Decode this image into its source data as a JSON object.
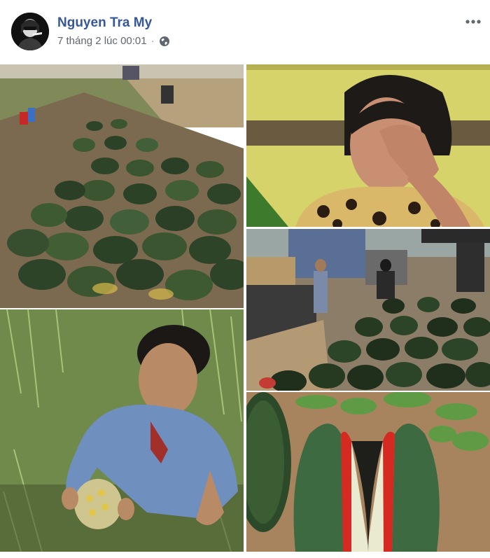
{
  "post": {
    "author_name": "Nguyen Tra My",
    "timestamp": "7 tháng 2 lúc 00:01",
    "separator": "·",
    "privacy_icon": "globe-icon",
    "more_icon": "more-options-icon"
  },
  "photos": [
    {
      "subject": "watermelon-pile-roadside"
    },
    {
      "subject": "woman-crying"
    },
    {
      "subject": "man-crying-field"
    },
    {
      "subject": "workers-watermelon-truck"
    },
    {
      "subject": "watermelon-split-open"
    }
  ],
  "colors": {
    "name_link": "#365899",
    "meta_text": "#606770",
    "melon_dark": "#2f4a2a",
    "melon_flesh": "#d42a22"
  }
}
